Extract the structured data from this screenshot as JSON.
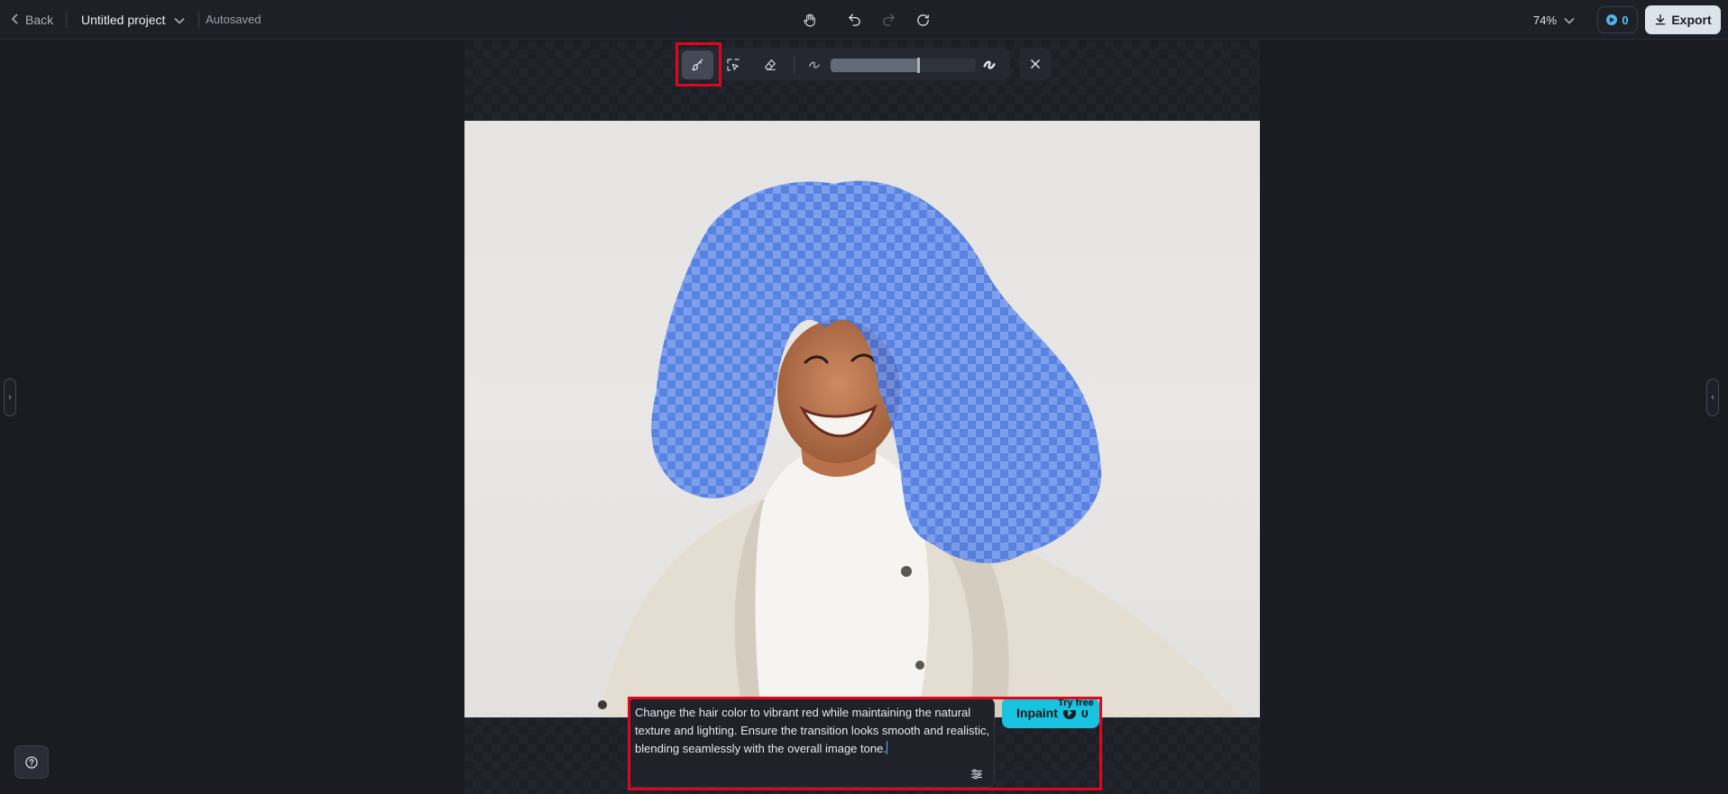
{
  "header": {
    "back_label": "Back",
    "project_name": "Untitled project",
    "save_status": "Autosaved",
    "zoom_level": "74%",
    "credits_count": "0",
    "export_label": "Export"
  },
  "inpaint_toolbar": {
    "tools": [
      "brush-icon",
      "smart-select-icon",
      "eraser-icon"
    ],
    "brush_size_fraction": 0.6
  },
  "prompt": {
    "text": "Change the hair color to vibrant red while maintaining the natural texture and lighting. Ensure the transition looks smooth and realistic, blending seamlessly with the overall image tone.",
    "submit_label": "Inpaint",
    "submit_cost": "0",
    "badge": "Try free"
  },
  "colors": {
    "accent": "#18c3df",
    "highlight": "#e0061d",
    "mask": "#3d6fe6"
  }
}
